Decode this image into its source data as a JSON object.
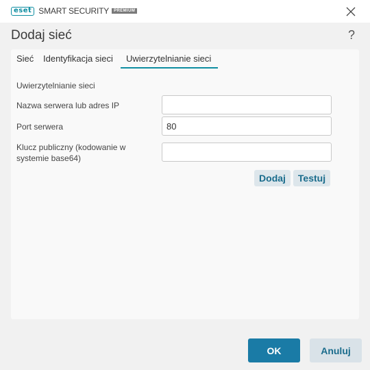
{
  "app": {
    "logo_badge": "eset",
    "product_name": "SMART SECURITY",
    "edition": "PREMIUM"
  },
  "window": {
    "close_icon": "close-icon",
    "help_label": "?"
  },
  "dialog": {
    "title": "Dodaj sieć"
  },
  "tabs": [
    {
      "label": "Sieć",
      "active": false
    },
    {
      "label": "Identyfikacja sieci",
      "active": false
    },
    {
      "label": "Uwierzytelnianie sieci",
      "active": true
    }
  ],
  "form": {
    "section_title": "Uwierzytelnianie sieci",
    "server_label": "Nazwa serwera lub adres IP",
    "server_value": "",
    "port_label": "Port serwera",
    "port_value": "80",
    "key_label": "Klucz publiczny (kodowanie w systemie base64)",
    "key_value": "",
    "add_label": "Dodaj",
    "test_label": "Testuj"
  },
  "footer": {
    "ok_label": "OK",
    "cancel_label": "Anuluj"
  },
  "colors": {
    "accent": "#0d8da1",
    "primary_button": "#1a7ba6",
    "secondary_button": "#d9e2e8"
  }
}
